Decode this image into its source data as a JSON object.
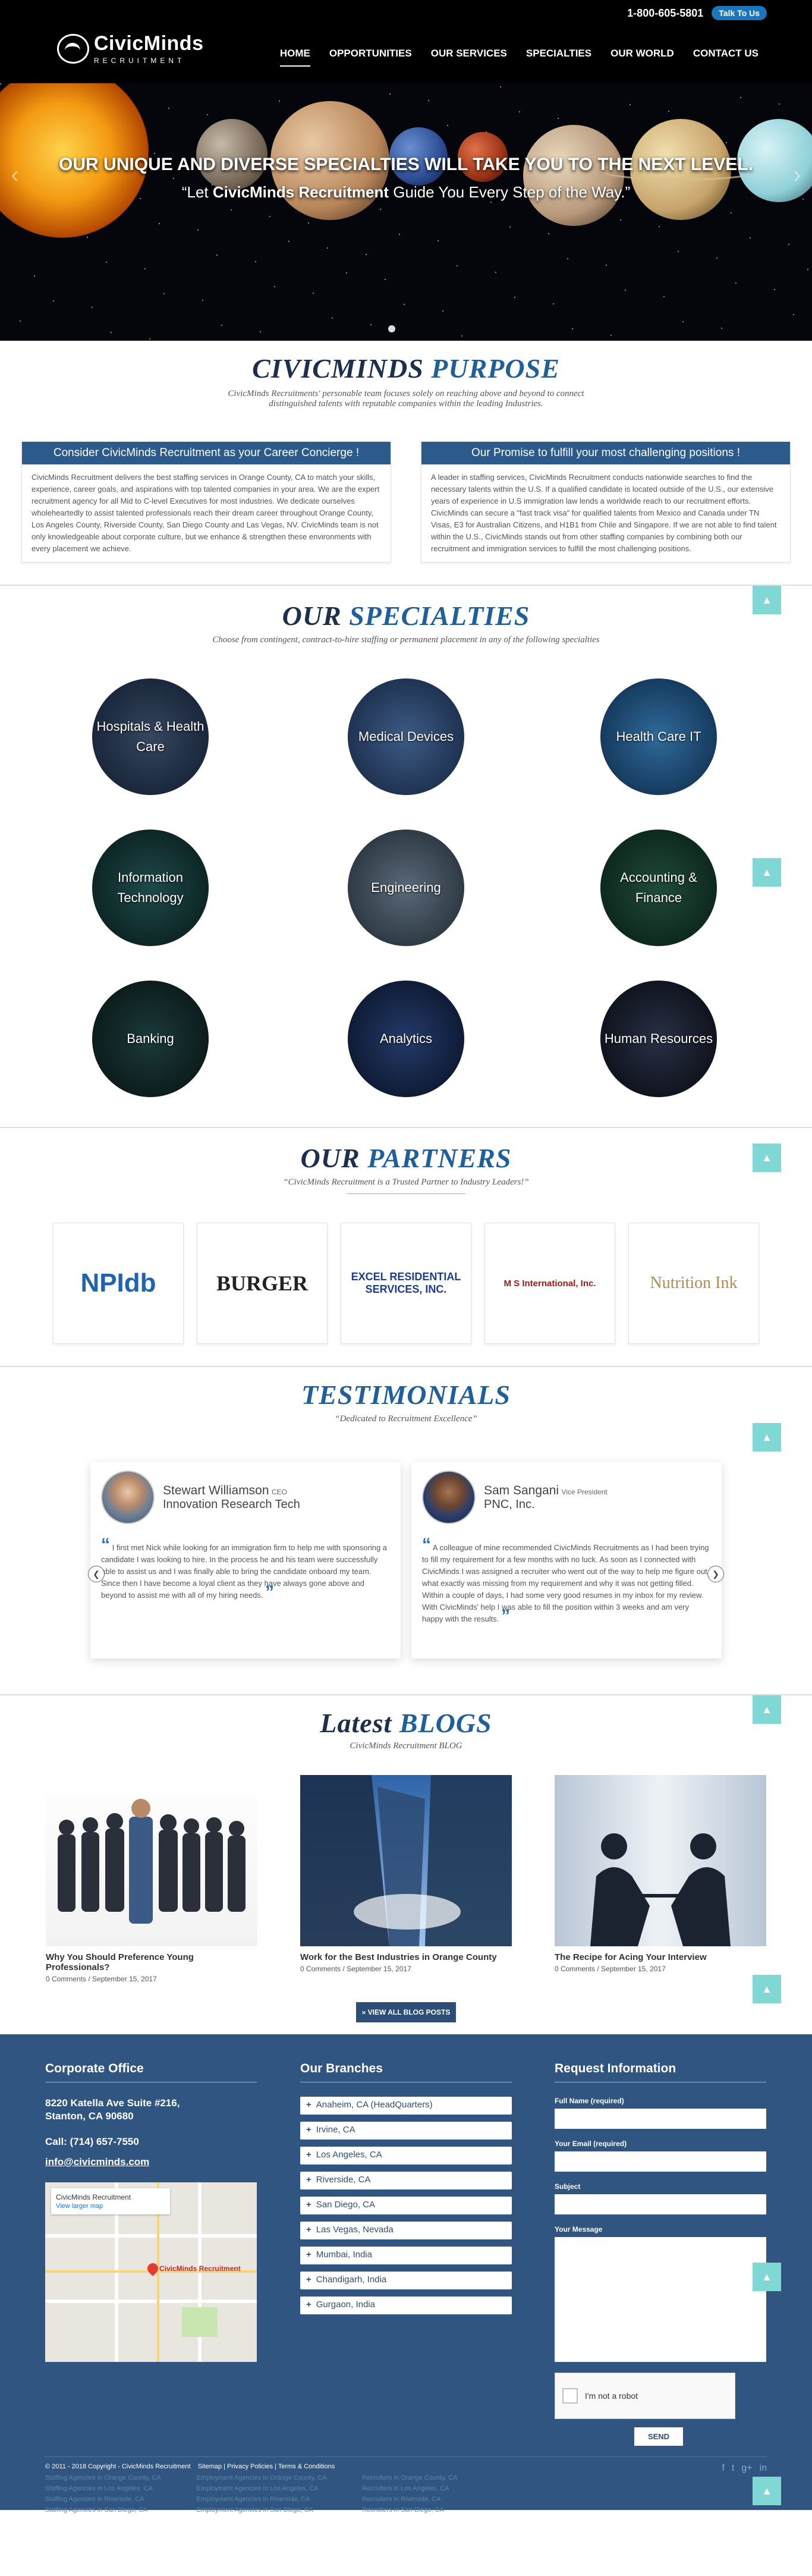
{
  "header": {
    "logo_name": "CivicMinds",
    "logo_sub": "RECRUITMENT",
    "phone": "1-800-605-5801",
    "talk_label": "Talk To Us",
    "nav": [
      "HOME",
      "OPPORTUNITIES",
      "OUR SERVICES",
      "SPECIALTIES",
      "OUR WORLD",
      "CONTACT US"
    ]
  },
  "hero": {
    "title": "OUR UNIQUE AND DIVERSE SPECIALTIES WILL TAKE YOU TO THE NEXT LEVEL.",
    "sub_prefix": "“Let ",
    "sub_brand": "CivicMinds Recruitment",
    "sub_suffix": " Guide You Every Step of the Way.”"
  },
  "purpose": {
    "title_a": "CIVICMINDS ",
    "title_b": "PURPOSE",
    "subtitle": "CivicMinds Recruitments' personable team focuses solely on reaching above and beyond to connect distinguished talents with reputable companies within the leading Industries.",
    "box1_title": "Consider CivicMinds Recruitment as your Career Concierge !",
    "box1_text": "CivicMinds Recruitment delivers the best staffing services in Orange County, CA to match your skills, experience, career goals, and aspirations with top talented companies in your area. We are the expert recruitment agency for all Mid to C-level Executives for most industries. We dedicate ourselves wholeheartedly to assist talented professionals reach their dream career throughout Orange County, Los Angeles County, Riverside County, San Diego County and Las Vegas, NV. CivicMinds team is not only knowledgeable about corporate culture, but we enhance & strengthen these environments with every placement we achieve.",
    "box2_title": "Our Promise to fulfill your most challenging positions !",
    "box2_text": "A leader in staffing services, CivicMinds Recruitment conducts nationwide searches to find the necessary talents within the U.S. If a qualified candidate is located outside of the U.S., our extensive years of experience in U.S immigration law lends a worldwide reach to our recruitment efforts. CivicMinds can secure a \"fast track visa\" for qualified talents from Mexico and Canada under TN Visas, E3 for Australian Citizens, and H1B1 from Chile and Singapore. If we are not able to find talent within the U.S., CivicMinds stands out from other staffing companies by combining both our recruitment and immigration services to fulfill the most challenging positions."
  },
  "specialties": {
    "title_a": "OUR ",
    "title_b": "SPECIALTIES",
    "subtitle": "Choose from contingent, contract-to-hire staffing or permanent placement in any of the following specialties",
    "items": [
      "Hospitals & Health Care",
      "Medical Devices",
      "Health Care IT",
      "Information Technology",
      "Engineering",
      "Accounting & Finance",
      "Banking",
      "Analytics",
      "Human Resources"
    ]
  },
  "partners": {
    "title_a": "OUR ",
    "title_b": "PARTNERS",
    "subtitle": "“CivicMinds Recruitment is a Trusted Partner to Industry Leaders!”",
    "logos": [
      "NPIdb",
      "BURGER",
      "EXCEL RESIDENTIAL SERVICES, INC.",
      "M S International, Inc.",
      "Nutrition Ink"
    ]
  },
  "testimonials": {
    "title": "TESTIMONIALS",
    "subtitle": "“Dedicated to Recruitment Excellence”",
    "items": [
      {
        "name": "Stewart Williamson",
        "role": "CEO",
        "company": "Innovation Research Tech",
        "text": "I first met Nick while looking for an immigration firm to help me with sponsoring a candidate I was looking to hire. In the process he and his team were successfully able to assist us and I was finally able to bring the candidate onboard my team. Since then I have become a loyal client as they have always gone above and beyond to assist me with all of my hiring needs."
      },
      {
        "name": "Sam Sangani",
        "role": "Vice President",
        "company": "PNC, Inc.",
        "text": "A colleague of mine recommended CivicMinds Recruitments as I had been trying to fill my requirement for a few months with no luck. As soon as I connected with CivicMinds I was assigned a recruiter who went out of the way to help me figure out what exactly was missing from my requirement and why it was not getting filled. Within a couple of days, I had some very good resumes in my inbox for my review. With CivicMinds' help I was able to fill the position within 3 weeks and am very happy with the results."
      }
    ]
  },
  "blogs": {
    "title_a": "Latest ",
    "title_b": "BLOGS",
    "subtitle": "CivicMinds Recruitment BLOG",
    "items": [
      {
        "title": "Why You Should Preference Young Professionals?",
        "meta": "0 Comments / September 15, 2017"
      },
      {
        "title": "Work for the Best Industries in Orange County",
        "meta": "0 Comments / September 15, 2017"
      },
      {
        "title": "The Recipe for Acing Your Interview",
        "meta": "0 Comments / September 15, 2017"
      }
    ],
    "view_all": "» VIEW ALL BLOG POSTS"
  },
  "footer": {
    "office_title": "Corporate Office",
    "address_line1": "8220 Katella Ave Suite #216,",
    "address_line2": "Stanton, CA 90680",
    "phone": "Call: (714) 657-7550",
    "email": "info@civicminds.com",
    "map_name": "CivicMinds Recruitment",
    "map_link": "View larger map",
    "map_pin_label": "CivicMinds Recruitment",
    "branches_title": "Our Branches",
    "branches": [
      "Anaheim, CA (HeadQuarters)",
      "Irvine, CA",
      "Los Angeles, CA",
      "Riverside, CA",
      "San Diego, CA",
      "Las Vegas, Nevada",
      "Mumbai, India",
      "Chandigarh, India",
      "Gurgaon, India"
    ],
    "request_title": "Request Information",
    "label_name": "Full Name (required)",
    "label_email": "Your Email (required)",
    "label_subject": "Subject",
    "label_message": "Your Message",
    "captcha_label": "I'm not a robot",
    "send_label": "SEND",
    "copyright": "© 2011 - 2018 Copyright - CivicMinds Recruitment",
    "links": "Sitemap | Privacy Policies | Terms & Conditions",
    "bottom_col1": [
      "Staffing Agencies in Orange County, CA",
      "Staffing Agencies in Los Angeles, CA",
      "Staffing Agencies in Riverside, CA",
      "Staffing Agencies in San Diego, CA"
    ],
    "bottom_col2": [
      "Employment Agencies in Orange County, CA",
      "Employment Agencies in Los Angeles, CA",
      "Employment Agencies in Riverside, CA",
      "Employment Agencies in San Diego, CA"
    ],
    "bottom_col3": [
      "Recruiters in Orange County, CA",
      "Recruiters in Los Angeles, CA",
      "Recruiters in Riverside, CA",
      "Recruiters in San Diego, CA"
    ]
  }
}
